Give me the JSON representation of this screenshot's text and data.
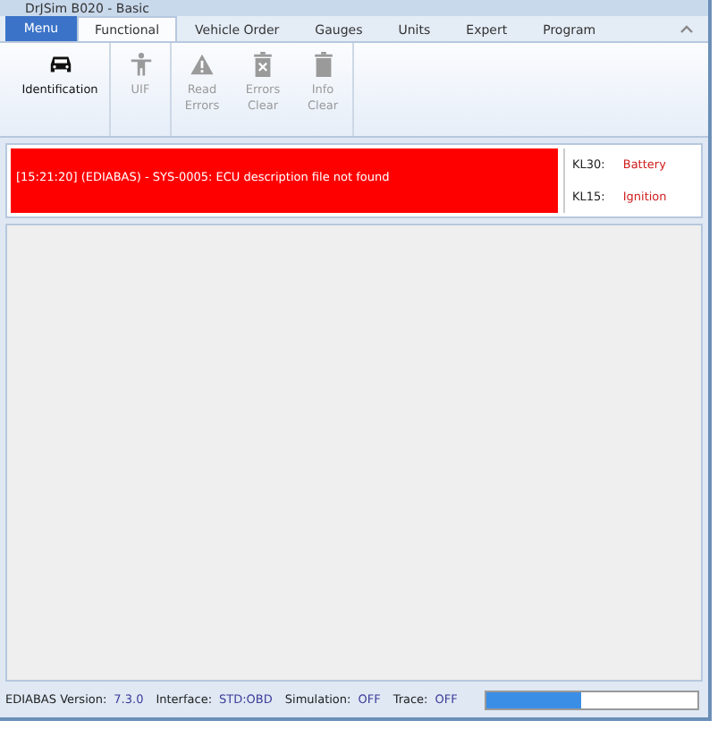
{
  "window": {
    "title": "DrJSim B020 - Basic"
  },
  "menu_button": "Menu",
  "tabs": [
    {
      "label": "Functional",
      "selected": true
    },
    {
      "label": "Vehicle Order",
      "selected": false
    },
    {
      "label": "Gauges",
      "selected": false
    },
    {
      "label": "Units",
      "selected": false
    },
    {
      "label": "Expert",
      "selected": false
    },
    {
      "label": "Program",
      "selected": false
    }
  ],
  "ribbon": [
    {
      "label": "Identification",
      "kind": "car",
      "disabled": false
    },
    {
      "label": "UIF",
      "kind": "person",
      "disabled": true
    },
    {
      "label": "Read Errors",
      "kind": "warning",
      "disabled": true
    },
    {
      "label": "Errors Clear",
      "kind": "deletex",
      "disabled": true
    },
    {
      "label": "Info Clear",
      "kind": "delete",
      "disabled": true
    }
  ],
  "log": {
    "message": "[15:21:20] (EDIABAS) - SYS-0005: ECU description file not found",
    "error": true
  },
  "terminals": [
    {
      "name": "KL30:",
      "value": "Battery"
    },
    {
      "name": "KL15:",
      "value": "Ignition"
    }
  ],
  "status_bar": {
    "items": [
      {
        "label": "EDIABAS Version:",
        "value": "7.3.0"
      },
      {
        "label": "Interface:",
        "value": "STD:OBD"
      },
      {
        "label": "Simulation:",
        "value": "OFF"
      },
      {
        "label": "Trace:",
        "value": "OFF"
      }
    ],
    "progress": {
      "level": 0.45
    }
  }
}
